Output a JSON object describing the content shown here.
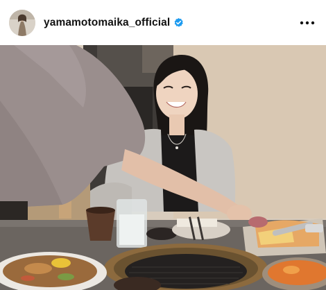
{
  "post": {
    "username": "yamamotomaika_official",
    "verified": true,
    "avatar_icon": "profile-avatar",
    "verified_icon": "verified-badge-icon",
    "more_icon": "more-options-icon"
  },
  "colors": {
    "verified_badge": "#1d9bf0",
    "text_primary": "#111111",
    "header_background": "#ffffff"
  }
}
